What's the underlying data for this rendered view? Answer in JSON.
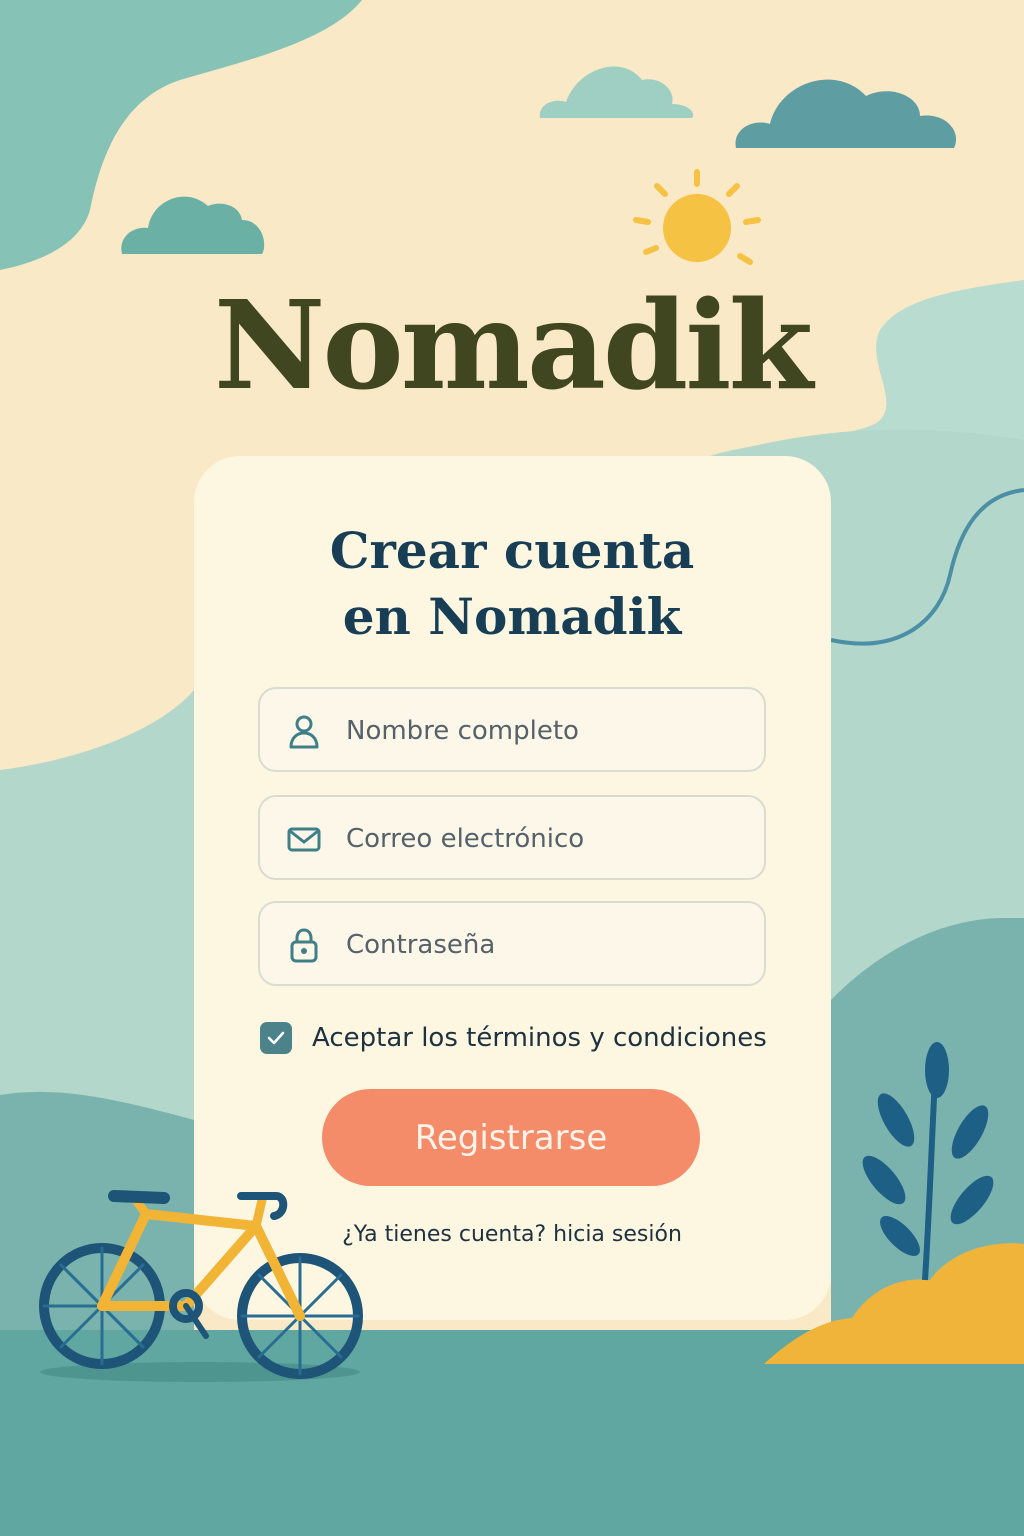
{
  "app": {
    "brand": "Nomadik"
  },
  "form": {
    "title_line1": "Crear cuenta",
    "title_line2": "en Nomadik",
    "fields": [
      {
        "placeholder": "Nombre completo",
        "icon": "user-icon"
      },
      {
        "placeholder": "Correo electrónico",
        "icon": "mail-icon"
      },
      {
        "placeholder": "Contraseña",
        "icon": "lock-icon"
      }
    ],
    "terms_label": "Aceptar los términos y condiciones",
    "terms_checked": true,
    "submit_label": "Registrarse",
    "login_prompt": "¿Ya tienes cuenta?",
    "login_link": "hicia sesión"
  },
  "colors": {
    "background": "#f9e9c6",
    "card": "#fdf6e1",
    "brand_text": "#3f4620",
    "title_text": "#173e55",
    "accent_teal": "#4c8289",
    "button": "#f48c6a",
    "sun": "#f6c244"
  }
}
